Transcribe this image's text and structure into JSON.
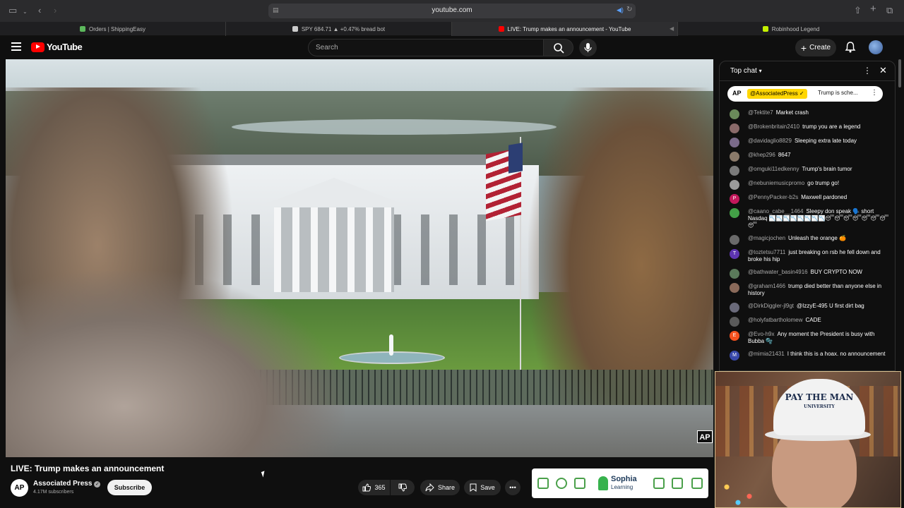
{
  "browser": {
    "url": "youtube.com",
    "tabs": [
      {
        "label": "Orders | ShippingEasy",
        "color": "#5cb85c"
      },
      {
        "label": "SPY 684.71 ▲ +0.47% bread bot",
        "color": "#cccccc"
      },
      {
        "label": "LIVE: Trump makes an announcement - YouTube",
        "color": "#ff0000"
      },
      {
        "label": "Robinhood Legend",
        "color": "#c4f000"
      }
    ]
  },
  "header": {
    "logo_text": "YouTube",
    "search_placeholder": "Search",
    "create_label": "Create"
  },
  "video": {
    "title": "LIVE: Trump makes an announcement",
    "watermark": "AP",
    "channel": {
      "avatar_text": "AP",
      "name": "Associated Press",
      "subscribers": "4.17M subscribers",
      "subscribe_label": "Subscribe"
    },
    "actions": {
      "likes": "365",
      "share_label": "Share",
      "save_label": "Save"
    }
  },
  "ad": {
    "brand": "Sophia",
    "brand_sub": "Learning"
  },
  "chat": {
    "mode_label": "Top chat",
    "pinned": {
      "avatar_text": "AP",
      "author": "@AssociatedPress ✓",
      "message": "Trump is sche..."
    },
    "messages": [
      {
        "author": "@Tektite7",
        "text": "Market crash",
        "avatar_color": "#6a8a5a",
        "avatar_text": ""
      },
      {
        "author": "@Brokenbritain2410",
        "text": "trump you are a legend",
        "avatar_color": "#8a6a6a",
        "avatar_text": ""
      },
      {
        "author": "@davidaglio8829",
        "text": "Sleeping extra late today",
        "avatar_color": "#7a6a8a",
        "avatar_text": ""
      },
      {
        "author": "@khep296",
        "text": "8647",
        "avatar_color": "#8a7a6a",
        "avatar_text": ""
      },
      {
        "author": "@omguki11edkenny",
        "text": "Trump's brain tumor",
        "avatar_color": "#7a7a7a",
        "avatar_text": ""
      },
      {
        "author": "@nebuniemusicpromo",
        "text": "go trump go!",
        "avatar_color": "#9a9a9a",
        "avatar_text": ""
      },
      {
        "author": "@PennyPacker-b2s",
        "text": "Maxwell pardoned",
        "avatar_color": "#c2185b",
        "avatar_text": "P"
      },
      {
        "author": "@caano_cabe__1464",
        "text": "Sleepy don speak 🗣️ short Nasdaq 📉📉📉📉📉📉📉📉😴😴😴😴😴😴😴😴",
        "avatar_color": "#43a047",
        "avatar_text": ""
      },
      {
        "author": "@magicjochen",
        "text": "Unleash the orange 🍊",
        "avatar_color": "#6a6a6a",
        "avatar_text": ""
      },
      {
        "author": "@toztetsu7711",
        "text": "just breaking on rsb he fell down and broke his hip",
        "avatar_color": "#5e35b1",
        "avatar_text": "T"
      },
      {
        "author": "@bathwater_basin4916",
        "text": "BUY CRYPTO NOW",
        "avatar_color": "#5a7a5a",
        "avatar_text": ""
      },
      {
        "author": "@graham1466",
        "text": "trump died better than anyone else in history",
        "avatar_color": "#8a6a5a",
        "avatar_text": ""
      },
      {
        "author": "@DirkDiggler-jl9gt",
        "text": "@IzzyE-495 U first dirt bag",
        "avatar_color": "#6a6a7a",
        "avatar_text": ""
      },
      {
        "author": "@holyfatbartholomew",
        "text": "CADE",
        "avatar_color": "#5a5a5a",
        "avatar_text": ""
      },
      {
        "author": "@Evo-h9x",
        "text": "Any moment the President is busy with Bubba 🫧",
        "avatar_color": "#f4511e",
        "avatar_text": "E"
      },
      {
        "author": "@mimia21431",
        "text": "I think this is a hoax. no announcement",
        "avatar_color": "#3949ab",
        "avatar_text": "M"
      }
    ]
  },
  "webcam": {
    "hat_line1": "PAY THE MAN",
    "hat_line2": "UNIVERSITY"
  }
}
